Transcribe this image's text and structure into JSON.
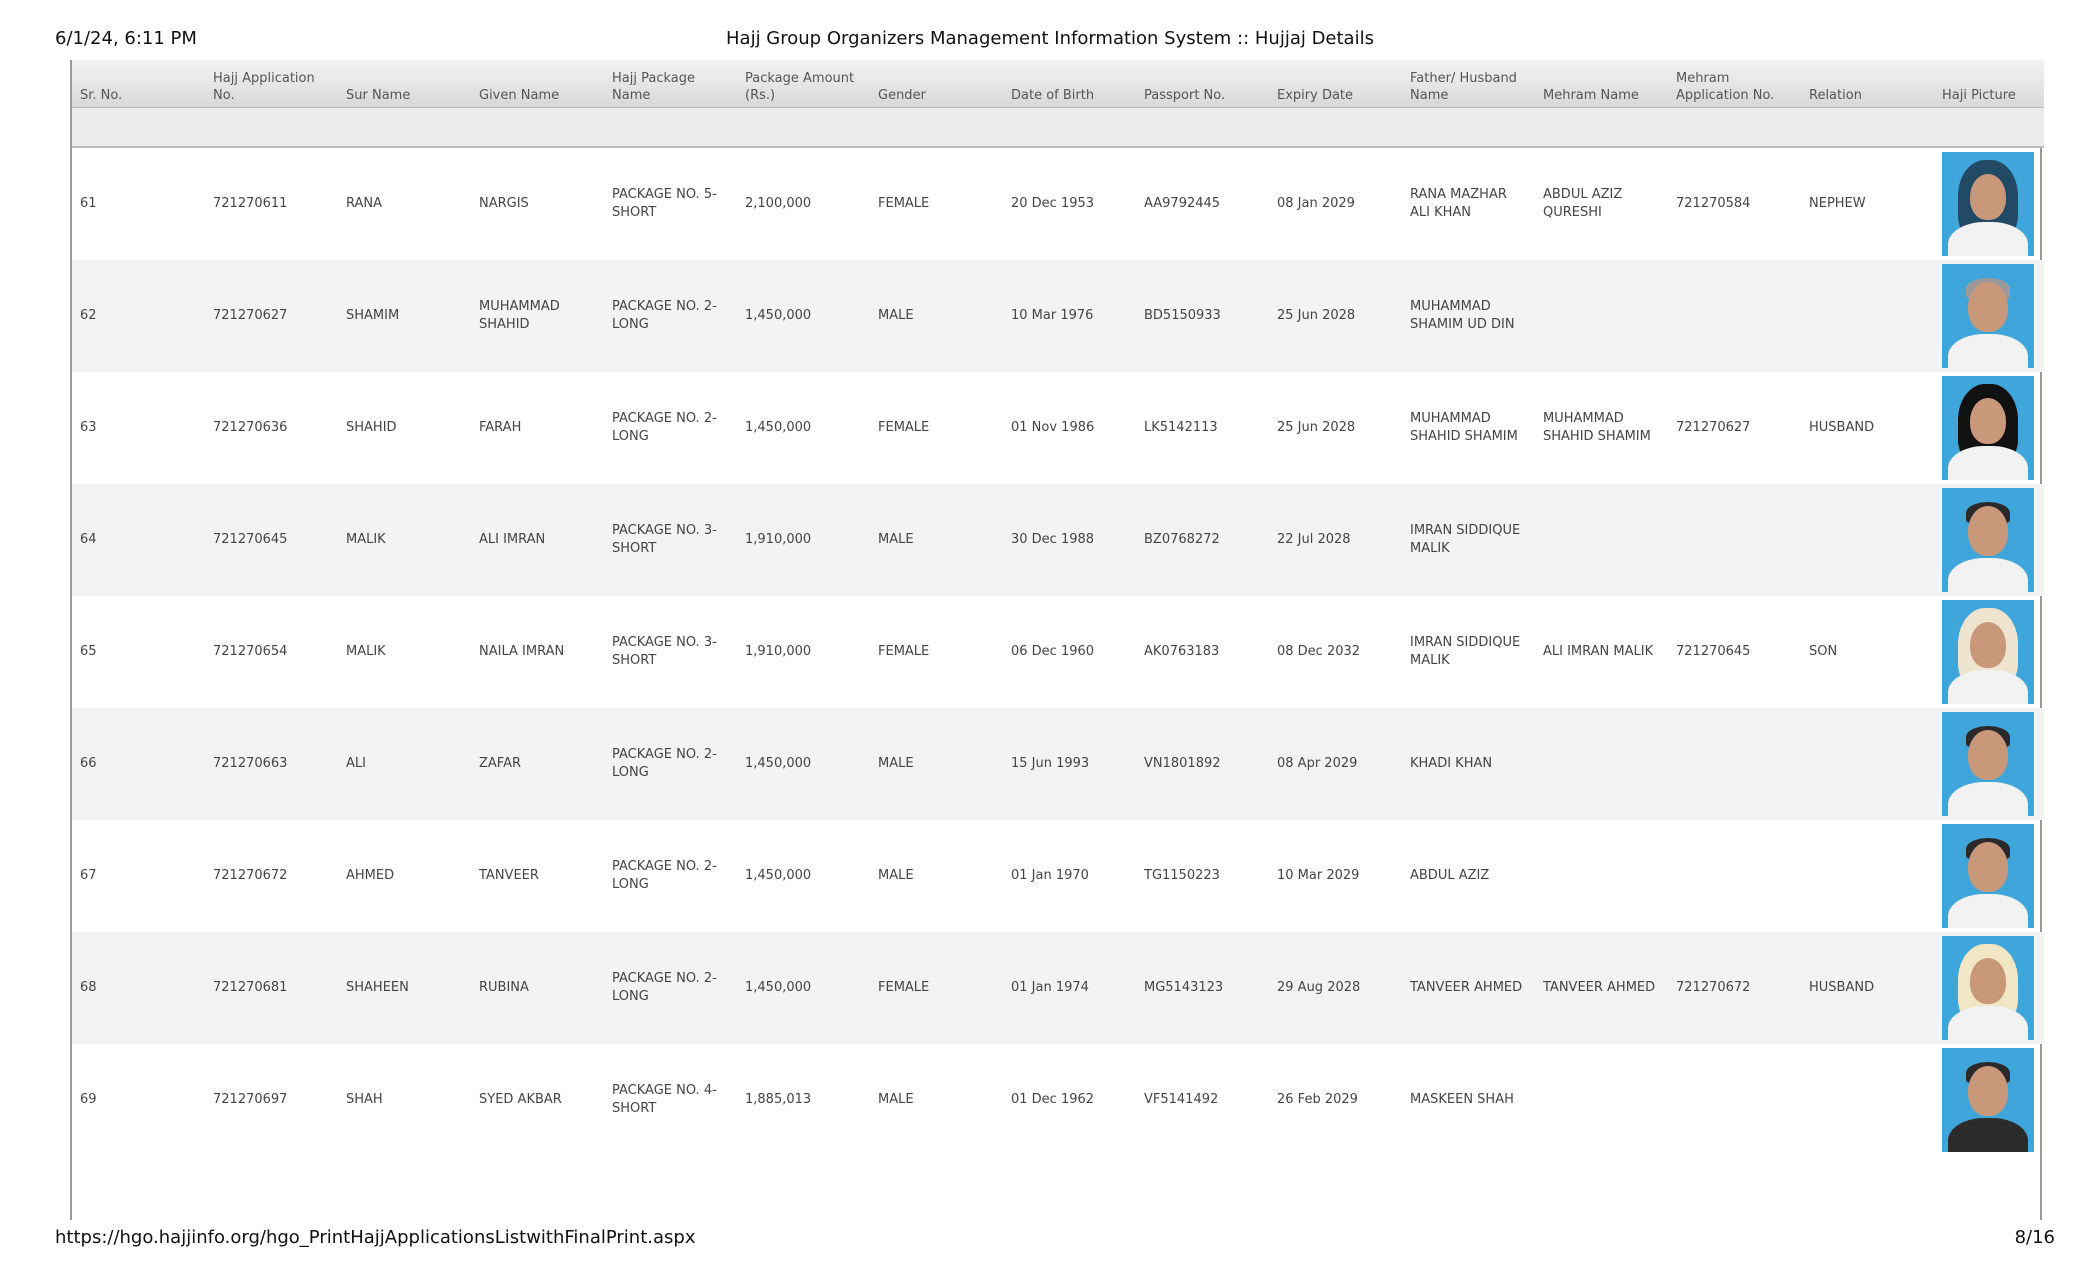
{
  "header": {
    "print_date": "6/1/24, 6:11 PM",
    "title": "Hajj Group Organizers Management Information System :: Hujjaj Details"
  },
  "footer": {
    "url": "https://hgo.hajjinfo.org/hgo_PrintHajjApplicationsListwithFinalPrint.aspx",
    "page": "8/16"
  },
  "columns": [
    "Sr. No.",
    "Hajj Application No.",
    "Sur Name",
    "Given Name",
    "Hajj Package Name",
    "Package Amount (Rs.)",
    "Gender",
    "Date of Birth",
    "Passport No.",
    "Expiry Date",
    "Father/ Husband Name",
    "Mehram Name",
    "Mehram Application No.",
    "Relation",
    "Haji Picture"
  ],
  "rows": [
    {
      "sr": "61",
      "app": "721270611",
      "sur": "RANA",
      "given": "NARGIS",
      "package": "PACKAGE NO. 5-SHORT",
      "amount": "2,100,000",
      "gender": "FEMALE",
      "dob": "20 Dec 1953",
      "passport": "AA9792445",
      "expiry": "08 Jan 2029",
      "father": "RANA MAZHAR ALI KHAN",
      "mehram": "ABDUL AZIZ QURESHI",
      "mehram_app": "721270584",
      "relation": "NEPHEW",
      "picture_icon": "haji-photo-female"
    },
    {
      "sr": "62",
      "app": "721270627",
      "sur": "SHAMIM",
      "given": "MUHAMMAD SHAHID",
      "package": "PACKAGE NO. 2-LONG",
      "amount": "1,450,000",
      "gender": "MALE",
      "dob": "10 Mar 1976",
      "passport": "BD5150933",
      "expiry": "25 Jun 2028",
      "father": "MUHAMMAD SHAMIM UD DIN",
      "mehram": "",
      "mehram_app": "",
      "relation": "",
      "picture_icon": "haji-photo-male"
    },
    {
      "sr": "63",
      "app": "721270636",
      "sur": "SHAHID",
      "given": "FARAH",
      "package": "PACKAGE NO. 2-LONG",
      "amount": "1,450,000",
      "gender": "FEMALE",
      "dob": "01 Nov 1986",
      "passport": "LK5142113",
      "expiry": "25 Jun 2028",
      "father": "MUHAMMAD SHAHID SHAMIM",
      "mehram": "MUHAMMAD SHAHID SHAMIM",
      "mehram_app": "721270627",
      "relation": "HUSBAND",
      "picture_icon": "haji-photo-female"
    },
    {
      "sr": "64",
      "app": "721270645",
      "sur": "MALIK",
      "given": "ALI IMRAN",
      "package": "PACKAGE NO. 3-SHORT",
      "amount": "1,910,000",
      "gender": "MALE",
      "dob": "30 Dec 1988",
      "passport": "BZ0768272",
      "expiry": "22 Jul 2028",
      "father": "IMRAN SIDDIQUE MALIK",
      "mehram": "",
      "mehram_app": "",
      "relation": "",
      "picture_icon": "haji-photo-male"
    },
    {
      "sr": "65",
      "app": "721270654",
      "sur": "MALIK",
      "given": "NAILA IMRAN",
      "package": "PACKAGE NO. 3-SHORT",
      "amount": "1,910,000",
      "gender": "FEMALE",
      "dob": "06 Dec 1960",
      "passport": "AK0763183",
      "expiry": "08 Dec 2032",
      "father": "IMRAN SIDDIQUE MALIK",
      "mehram": "ALI IMRAN MALIK",
      "mehram_app": "721270645",
      "relation": "SON",
      "picture_icon": "haji-photo-female"
    },
    {
      "sr": "66",
      "app": "721270663",
      "sur": "ALI",
      "given": "ZAFAR",
      "package": "PACKAGE NO. 2-LONG",
      "amount": "1,450,000",
      "gender": "MALE",
      "dob": "15 Jun 1993",
      "passport": "VN1801892",
      "expiry": "08 Apr 2029",
      "father": "KHADI KHAN",
      "mehram": "",
      "mehram_app": "",
      "relation": "",
      "picture_icon": "haji-photo-male"
    },
    {
      "sr": "67",
      "app": "721270672",
      "sur": "AHMED",
      "given": "TANVEER",
      "package": "PACKAGE NO. 2-LONG",
      "amount": "1,450,000",
      "gender": "MALE",
      "dob": "01 Jan 1970",
      "passport": "TG1150223",
      "expiry": "10 Mar 2029",
      "father": "ABDUL AZIZ",
      "mehram": "",
      "mehram_app": "",
      "relation": "",
      "picture_icon": "haji-photo-male"
    },
    {
      "sr": "68",
      "app": "721270681",
      "sur": "SHAHEEN",
      "given": "RUBINA",
      "package": "PACKAGE NO. 2-LONG",
      "amount": "1,450,000",
      "gender": "FEMALE",
      "dob": "01 Jan 1974",
      "passport": "MG5143123",
      "expiry": "29 Aug 2028",
      "father": "TANVEER AHMED",
      "mehram": "TANVEER AHMED",
      "mehram_app": "721270672",
      "relation": "HUSBAND",
      "picture_icon": "haji-photo-female"
    },
    {
      "sr": "69",
      "app": "721270697",
      "sur": "SHAH",
      "given": "SYED AKBAR",
      "package": "PACKAGE NO. 4-SHORT",
      "amount": "1,885,013",
      "gender": "MALE",
      "dob": "01 Dec 1962",
      "passport": "VF5141492",
      "expiry": "26 Feb 2029",
      "father": "MASKEEN SHAH",
      "mehram": "",
      "mehram_app": "",
      "relation": "",
      "picture_icon": "haji-photo-male"
    }
  ]
}
